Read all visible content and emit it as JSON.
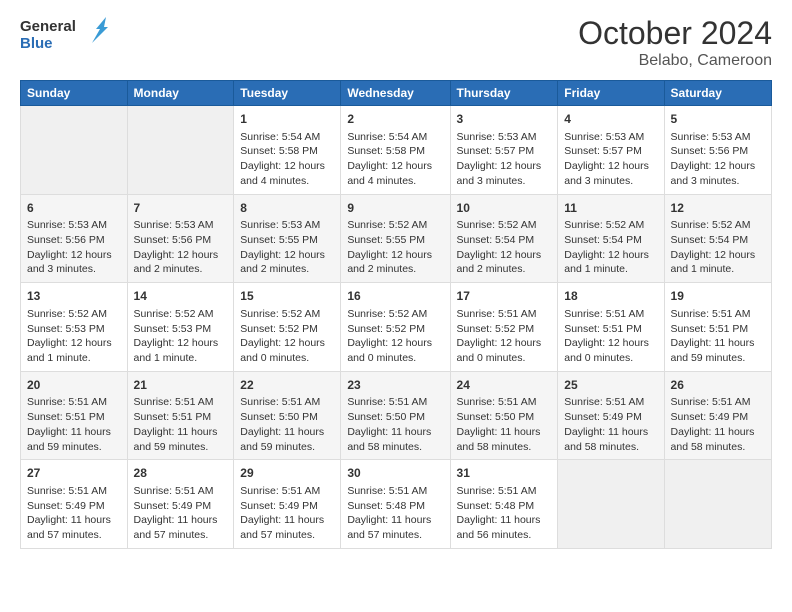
{
  "logo": {
    "text_general": "General",
    "text_blue": "Blue"
  },
  "header": {
    "month": "October 2024",
    "location": "Belabo, Cameroon"
  },
  "weekdays": [
    "Sunday",
    "Monday",
    "Tuesday",
    "Wednesday",
    "Thursday",
    "Friday",
    "Saturday"
  ],
  "weeks": [
    [
      {
        "day": "",
        "empty": true
      },
      {
        "day": "",
        "empty": true
      },
      {
        "day": "1",
        "sunrise": "5:54 AM",
        "sunset": "5:58 PM",
        "daylight": "12 hours and 4 minutes."
      },
      {
        "day": "2",
        "sunrise": "5:54 AM",
        "sunset": "5:58 PM",
        "daylight": "12 hours and 4 minutes."
      },
      {
        "day": "3",
        "sunrise": "5:53 AM",
        "sunset": "5:57 PM",
        "daylight": "12 hours and 3 minutes."
      },
      {
        "day": "4",
        "sunrise": "5:53 AM",
        "sunset": "5:57 PM",
        "daylight": "12 hours and 3 minutes."
      },
      {
        "day": "5",
        "sunrise": "5:53 AM",
        "sunset": "5:56 PM",
        "daylight": "12 hours and 3 minutes."
      }
    ],
    [
      {
        "day": "6",
        "sunrise": "5:53 AM",
        "sunset": "5:56 PM",
        "daylight": "12 hours and 3 minutes."
      },
      {
        "day": "7",
        "sunrise": "5:53 AM",
        "sunset": "5:56 PM",
        "daylight": "12 hours and 2 minutes."
      },
      {
        "day": "8",
        "sunrise": "5:53 AM",
        "sunset": "5:55 PM",
        "daylight": "12 hours and 2 minutes."
      },
      {
        "day": "9",
        "sunrise": "5:52 AM",
        "sunset": "5:55 PM",
        "daylight": "12 hours and 2 minutes."
      },
      {
        "day": "10",
        "sunrise": "5:52 AM",
        "sunset": "5:54 PM",
        "daylight": "12 hours and 2 minutes."
      },
      {
        "day": "11",
        "sunrise": "5:52 AM",
        "sunset": "5:54 PM",
        "daylight": "12 hours and 1 minute."
      },
      {
        "day": "12",
        "sunrise": "5:52 AM",
        "sunset": "5:54 PM",
        "daylight": "12 hours and 1 minute."
      }
    ],
    [
      {
        "day": "13",
        "sunrise": "5:52 AM",
        "sunset": "5:53 PM",
        "daylight": "12 hours and 1 minute."
      },
      {
        "day": "14",
        "sunrise": "5:52 AM",
        "sunset": "5:53 PM",
        "daylight": "12 hours and 1 minute."
      },
      {
        "day": "15",
        "sunrise": "5:52 AM",
        "sunset": "5:52 PM",
        "daylight": "12 hours and 0 minutes."
      },
      {
        "day": "16",
        "sunrise": "5:52 AM",
        "sunset": "5:52 PM",
        "daylight": "12 hours and 0 minutes."
      },
      {
        "day": "17",
        "sunrise": "5:51 AM",
        "sunset": "5:52 PM",
        "daylight": "12 hours and 0 minutes."
      },
      {
        "day": "18",
        "sunrise": "5:51 AM",
        "sunset": "5:51 PM",
        "daylight": "12 hours and 0 minutes."
      },
      {
        "day": "19",
        "sunrise": "5:51 AM",
        "sunset": "5:51 PM",
        "daylight": "11 hours and 59 minutes."
      }
    ],
    [
      {
        "day": "20",
        "sunrise": "5:51 AM",
        "sunset": "5:51 PM",
        "daylight": "11 hours and 59 minutes."
      },
      {
        "day": "21",
        "sunrise": "5:51 AM",
        "sunset": "5:51 PM",
        "daylight": "11 hours and 59 minutes."
      },
      {
        "day": "22",
        "sunrise": "5:51 AM",
        "sunset": "5:50 PM",
        "daylight": "11 hours and 59 minutes."
      },
      {
        "day": "23",
        "sunrise": "5:51 AM",
        "sunset": "5:50 PM",
        "daylight": "11 hours and 58 minutes."
      },
      {
        "day": "24",
        "sunrise": "5:51 AM",
        "sunset": "5:50 PM",
        "daylight": "11 hours and 58 minutes."
      },
      {
        "day": "25",
        "sunrise": "5:51 AM",
        "sunset": "5:49 PM",
        "daylight": "11 hours and 58 minutes."
      },
      {
        "day": "26",
        "sunrise": "5:51 AM",
        "sunset": "5:49 PM",
        "daylight": "11 hours and 58 minutes."
      }
    ],
    [
      {
        "day": "27",
        "sunrise": "5:51 AM",
        "sunset": "5:49 PM",
        "daylight": "11 hours and 57 minutes."
      },
      {
        "day": "28",
        "sunrise": "5:51 AM",
        "sunset": "5:49 PM",
        "daylight": "11 hours and 57 minutes."
      },
      {
        "day": "29",
        "sunrise": "5:51 AM",
        "sunset": "5:49 PM",
        "daylight": "11 hours and 57 minutes."
      },
      {
        "day": "30",
        "sunrise": "5:51 AM",
        "sunset": "5:48 PM",
        "daylight": "11 hours and 57 minutes."
      },
      {
        "day": "31",
        "sunrise": "5:51 AM",
        "sunset": "5:48 PM",
        "daylight": "11 hours and 56 minutes."
      },
      {
        "day": "",
        "empty": true
      },
      {
        "day": "",
        "empty": true
      }
    ]
  ],
  "cell_labels": {
    "sunrise": "Sunrise:",
    "sunset": "Sunset:",
    "daylight": "Daylight:"
  }
}
